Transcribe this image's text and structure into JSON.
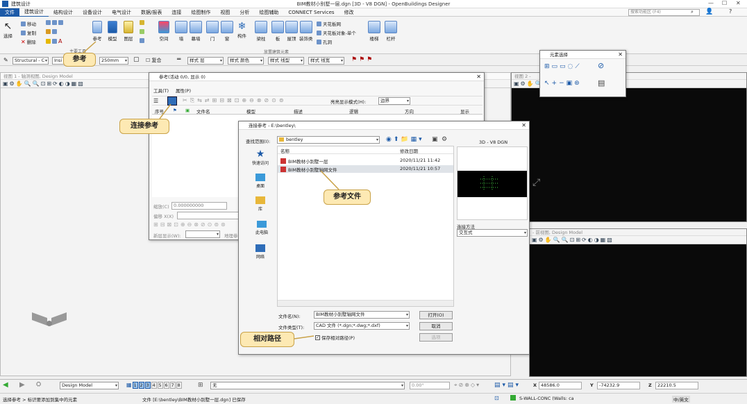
{
  "window": {
    "title": "BIM教材小别墅一层.dgn [3D - V8 DGN] - OpenBuildings Designer",
    "workflow": "建筑设计",
    "search_placeholder": "搜索功能区 (F4)"
  },
  "menu": [
    "文件",
    "建筑设计",
    "结构设计",
    "设备设计",
    "电气设计",
    "数据/报表",
    "连接",
    "绘图制作",
    "视图",
    "分析",
    "绘图辅助",
    "CONNECT Services",
    "修改"
  ],
  "ribbon": {
    "select": "选择",
    "move": "移动",
    "copy": "复制",
    "delete": "删除",
    "reference": "参考",
    "model": "模型",
    "layer": "图层",
    "space": "空间",
    "wall": "墙",
    "curtain": "幕墙",
    "door": "门",
    "window": "窗",
    "component": "构件",
    "beam": "梁柱",
    "slab": "板",
    "roof": "屋顶",
    "finish": "装饰类",
    "ceiling_grid": "天花板网",
    "ceiling_obj": "天花板对象-单个",
    "hole": "孔洞",
    "stair": "楼梯",
    "railing": "栏杆",
    "group_primary": "主要工具",
    "group_place": "放置建筑元素"
  },
  "propbar": {
    "standard": "Structural - C",
    "insert": "Insi",
    "thickness": "250mm",
    "composite": "复合",
    "level": "样式 层",
    "color": "样式 颜色",
    "weight": "样式 线型",
    "style": "样式 线宽"
  },
  "views": {
    "view1": "视图 1 - 轴测视图, Design Model",
    "view2": "视图 2 -",
    "view3": "- 前视图, Design Model"
  },
  "element_select": {
    "title": "元素选择"
  },
  "ref_dialog": {
    "title": "参考(活动 0/0, 显示 0)",
    "menu_tools": "工具(T)",
    "menu_props": "属性(P)",
    "highlight_label": "亮亮显示模式(H):",
    "highlight_value": "边界",
    "columns": [
      "序号",
      "",
      "",
      "文件名",
      "模型",
      "描述",
      "逻辑",
      "方向",
      "显示"
    ],
    "scale_label": "缩放(C)",
    "scale_value": "0.000000000",
    "offset_label": "偏移 X(X)",
    "nest_label": "新层显示(W):",
    "geo_label": "地理参"
  },
  "attach_dialog": {
    "title": "连接参考 - E:\\bentley\\",
    "lookin_label": "查找范围(I):",
    "lookin_value": "bentley",
    "nav": [
      "快速访问",
      "桌面",
      "库",
      "此电脑",
      "网络"
    ],
    "col_name": "名称",
    "col_date": "修改日期",
    "files": [
      {
        "name": "BIM教材小别墅一层",
        "date": "2020/11/21 11:42"
      },
      {
        "name": "BIM教材小别墅轴网文件",
        "date": "2020/11/21 10:57"
      }
    ],
    "preview_label": "3D - V8 DGN",
    "attach_method_label": "连接方法",
    "attach_method_value": "交互式",
    "filename_label": "文件名(N):",
    "filename_value": "BIM教材小别墅轴网文件",
    "filetype_label": "文件类型(T):",
    "filetype_value": "CAD 文件 (*.dgn;*.dwg;*.dxf)",
    "open": "打开(O)",
    "cancel": "取消",
    "options": "选项",
    "relative_path": "保存相对路径(P)"
  },
  "callouts": {
    "reference": "参考",
    "attach_ref": "连接参考",
    "ref_file": "参考文件",
    "relative": "相对路径"
  },
  "status": {
    "model": "Design Model",
    "views": [
      "1",
      "2",
      "3",
      "4",
      "5",
      "6",
      "7",
      "8"
    ],
    "level": "无",
    "angle": "0.00°",
    "x_label": "X",
    "x": "48586.0",
    "y_label": "Y",
    "y": "-74232.9",
    "z_label": "Z",
    "z": "22210.5",
    "left_msg": "选择参考 > 标识要添加到集中的元素",
    "file_msg": "文件 [E:\\bentley\\BIM教材小别墅一层.dgn] 已保存",
    "wall_msg": "S-WALL-CONC (Walls: ca",
    "ime": "中/英文"
  }
}
